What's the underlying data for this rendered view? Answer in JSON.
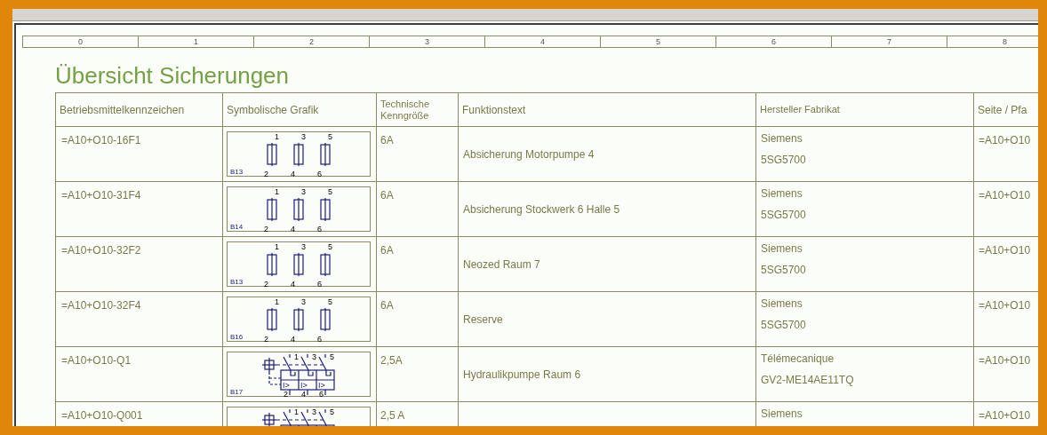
{
  "ruler": [
    "0",
    "1",
    "2",
    "3",
    "4",
    "5",
    "6",
    "7",
    "8"
  ],
  "title": "Übersicht Sicherungen",
  "table": {
    "columns": [
      "Betriebsmittelkennzeichen",
      "Symbolische Grafik",
      "Technische Kenngröße",
      "Funktionstext",
      "Hersteller Fabrikat",
      "Seite / Pfa"
    ],
    "rows": [
      {
        "designation": "=A10+O10-16F1",
        "graphic": {
          "kind": "fuse",
          "tag": "B13",
          "top_terminals": [
            "1",
            "3",
            "5"
          ],
          "bottom_terminals": [
            "2",
            "4",
            "6"
          ]
        },
        "rating": "6A",
        "function": "Absicherung Motorpumpe 4",
        "manufacturer": "Siemens",
        "part_number": "5SG5700",
        "page": "=A10+O10"
      },
      {
        "designation": "=A10+O10-31F4",
        "graphic": {
          "kind": "fuse",
          "tag": "B14",
          "top_terminals": [
            "1",
            "3",
            "5"
          ],
          "bottom_terminals": [
            "2",
            "4",
            "6"
          ]
        },
        "rating": "6A",
        "function": "Absicherung Stockwerk 6 Halle 5",
        "manufacturer": "Siemens",
        "part_number": "5SG5700",
        "page": "=A10+O10"
      },
      {
        "designation": "=A10+O10-32F2",
        "graphic": {
          "kind": "fuse",
          "tag": "B13",
          "top_terminals": [
            "1",
            "3",
            "5"
          ],
          "bottom_terminals": [
            "2",
            "4",
            "6"
          ]
        },
        "rating": "6A",
        "function": "Neozed Raum 7",
        "manufacturer": "Siemens",
        "part_number": "5SG5700",
        "page": "=A10+O10"
      },
      {
        "designation": "=A10+O10-32F4",
        "graphic": {
          "kind": "fuse",
          "tag": "B16",
          "top_terminals": [
            "1",
            "3",
            "5"
          ],
          "bottom_terminals": [
            "2",
            "4",
            "6"
          ]
        },
        "rating": "6A",
        "function": "Reserve",
        "manufacturer": "Siemens",
        "part_number": "5SG5700",
        "page": "=A10+O10"
      },
      {
        "designation": "=A10+O10-Q1",
        "graphic": {
          "kind": "breaker",
          "tag": "B17",
          "top_terminals": [
            "1",
            "3",
            "5"
          ],
          "bottom_terminals": [
            "2",
            "4",
            "6"
          ],
          "trip_labels": [
            "I>",
            "I>",
            "I>"
          ]
        },
        "rating": "2,5A",
        "function": "Hydraulikpumpe Raum 6",
        "manufacturer": "Télémecanique",
        "part_number": "GV2-ME14AE11TQ",
        "page": "=A10+O10"
      },
      {
        "designation": "=A10+O10-Q001",
        "graphic": {
          "kind": "breaker",
          "top_terminals": [
            "1",
            "3",
            "5"
          ]
        },
        "rating": "2,5 A",
        "manufacturer": "Siemens",
        "page": "=A10+O10"
      }
    ]
  }
}
